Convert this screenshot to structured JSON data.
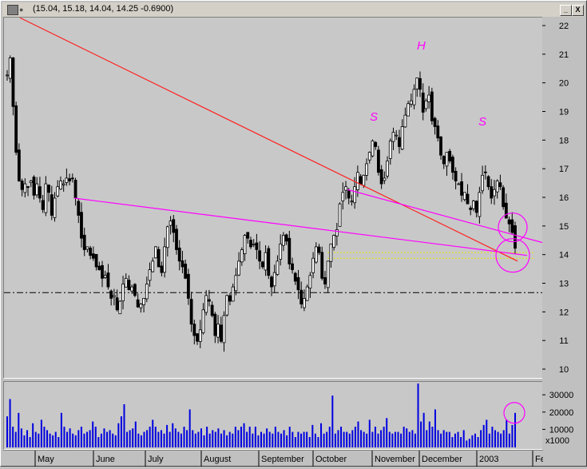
{
  "window": {
    "title": "(15.04, 15.18, 14.04, 14.25 -0.6900)",
    "buttons": {
      "minimize": "_",
      "close": "X"
    }
  },
  "annotations": {
    "left_shoulder": "S",
    "head": "H",
    "right_shoulder": "S"
  },
  "chart_data": [
    {
      "type": "candlestick",
      "title": "",
      "y_axis": {
        "ticks": [
          10,
          11,
          12,
          13,
          14,
          15,
          16,
          17,
          18,
          19,
          20,
          21,
          22
        ],
        "range": [
          9.8,
          22.2
        ],
        "side": "right"
      },
      "x_axis": {
        "labels": [
          "May",
          "June",
          "July",
          "August",
          "September",
          "October",
          "November",
          "December",
          "2003",
          "Fe"
        ]
      },
      "last_bar": {
        "open": 15.04,
        "high": 15.18,
        "low": 14.04,
        "close": 14.25,
        "change": -0.69
      },
      "closes": [
        20.3,
        20.9,
        19.2,
        17.6,
        16.6,
        16.3,
        16.5,
        16.4,
        16.6,
        16.1,
        16.5,
        16.0,
        15.6,
        16.5,
        16.2,
        15.4,
        16.0,
        16.4,
        16.6,
        16.5,
        16.7,
        16.6,
        16.7,
        16.0,
        15.4,
        14.6,
        14.2,
        14.3,
        14.0,
        13.9,
        13.6,
        13.5,
        13.2,
        13.3,
        12.9,
        12.5,
        12.6,
        12.1,
        12.4,
        13.0,
        13.2,
        12.8,
        12.9,
        12.6,
        12.2,
        12.3,
        12.5,
        13.0,
        13.5,
        13.8,
        14.3,
        13.6,
        13.4,
        14.3,
        15.0,
        15.2,
        14.8,
        14.2,
        13.8,
        13.6,
        13.2,
        12.5,
        11.6,
        11.2,
        11.0,
        11.4,
        12.1,
        12.6,
        12.4,
        11.9,
        11.2,
        11.6,
        11.0,
        11.9,
        12.6,
        12.4,
        12.9,
        13.3,
        13.8,
        14.2,
        14.7,
        14.6,
        14.3,
        14.4,
        14.2,
        13.8,
        13.6,
        14.1,
        13.3,
        12.9,
        13.4,
        13.8,
        14.4,
        14.7,
        14.5,
        13.7,
        13.5,
        13.1,
        12.8,
        12.3,
        12.5,
        12.9,
        13.3,
        13.9,
        14.3,
        14.1,
        13.2,
        13.0,
        13.8,
        14.4,
        14.7,
        14.9,
        15.8,
        16.2,
        16.4,
        16.0,
        15.9,
        16.4,
        16.9,
        16.5,
        16.8,
        17.2,
        17.6,
        18.0,
        17.8,
        16.9,
        16.5,
        16.7,
        17.3,
        18.0,
        18.3,
        18.2,
        17.8,
        18.5,
        18.9,
        19.3,
        19.4,
        19.8,
        20.2,
        19.8,
        19.0,
        19.4,
        19.6,
        18.7,
        18.5,
        18.1,
        17.5,
        17.2,
        17.6,
        17.3,
        16.9,
        16.6,
        16.5,
        16.1,
        16.2,
        15.8,
        15.6,
        15.9,
        15.5,
        16.2,
        16.8,
        16.9,
        16.4,
        16.0,
        16.3,
        16.6,
        16.4,
        15.7,
        15.3,
        15.1,
        14.8,
        14.25
      ],
      "support_level": 12.7,
      "yellow_band": [
        13.9,
        14.1
      ]
    },
    {
      "type": "bar",
      "title": "",
      "y_axis": {
        "ticks": [
          10000,
          20000,
          30000
        ],
        "unit_label": "x1000",
        "range": [
          0,
          37000
        ]
      },
      "values": [
        18000,
        28000,
        12000,
        9000,
        20000,
        11000,
        7000,
        10000,
        6000,
        14000,
        9000,
        8000,
        16000,
        12000,
        10000,
        8000,
        7000,
        9000,
        6000,
        20000,
        12000,
        9000,
        11000,
        8000,
        7000,
        10000,
        12000,
        8000,
        9000,
        10000,
        15000,
        12000,
        6000,
        8000,
        11000,
        9000,
        10000,
        8000,
        7000,
        14000,
        18000,
        25000,
        9000,
        10000,
        11000,
        15000,
        8000,
        7000,
        9000,
        10000,
        12000,
        16000,
        12000,
        9000,
        10000,
        8000,
        13000,
        9000,
        14000,
        11000,
        9000,
        8000,
        12000,
        10000,
        22000,
        10000,
        8000,
        9000,
        11000,
        7000,
        12000,
        8000,
        10000,
        9000,
        11000,
        8000,
        10000,
        7000,
        9000,
        8000,
        12000,
        10000,
        12000,
        14000,
        9000,
        12000,
        8000,
        12000,
        7000,
        9000,
        8000,
        11000,
        9000,
        8000,
        12000,
        9000,
        8000,
        10000,
        7000,
        12000,
        9000,
        6000,
        9000,
        8000,
        9000,
        9000,
        6000,
        13000,
        8000,
        6000,
        14000,
        8000,
        9000,
        12000,
        30000,
        8000,
        10000,
        12000,
        9000,
        9000,
        8000,
        10000,
        12000,
        15000,
        10000,
        9000,
        8000,
        16000,
        9000,
        12000,
        8000,
        10000,
        12000,
        17000,
        9000,
        8000,
        9000,
        9000,
        8000,
        12000,
        11000,
        9000,
        10000,
        8000,
        37000,
        15000,
        20000,
        10000,
        15000,
        12000,
        22000,
        10000,
        8000,
        10000,
        9000,
        9000,
        6000,
        8000,
        9000,
        6000,
        10000,
        4000,
        5000,
        7000,
        8000,
        6000,
        10000,
        13000,
        16000,
        8000,
        12000,
        10000,
        9000,
        8000,
        10000,
        16000,
        8000,
        13000,
        20000
      ]
    }
  ]
}
